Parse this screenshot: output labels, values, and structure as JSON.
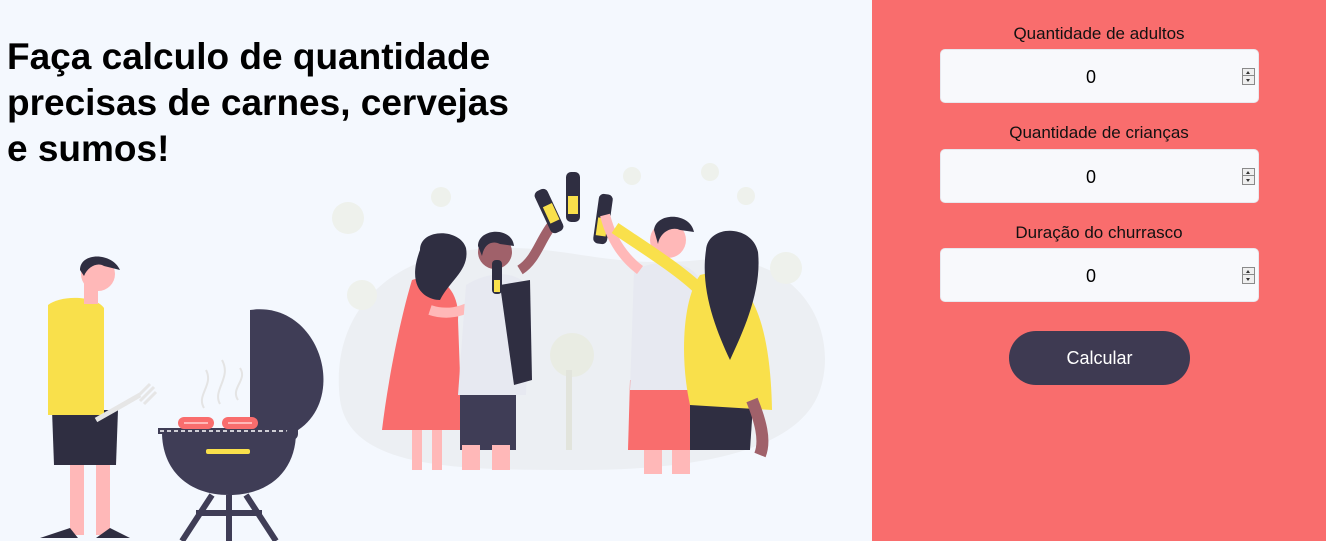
{
  "headline": "Faça calculo de quantidade precisas de carnes, cervejas e sumos!",
  "form": {
    "adults": {
      "label": "Quantidade de adultos",
      "value": "0"
    },
    "children": {
      "label": "Quantidade de crianças",
      "value": "0"
    },
    "duration": {
      "label": "Duração do churrasco",
      "value": "0"
    },
    "submit_label": "Calcular"
  },
  "colors": {
    "background": "#f4f8fe",
    "panel": "#f96d6d",
    "button": "#3e3a52",
    "accent_yellow": "#f9e04b",
    "dark_figure": "#3f3d56"
  },
  "illustration": "people-barbecue-toast-illustration"
}
